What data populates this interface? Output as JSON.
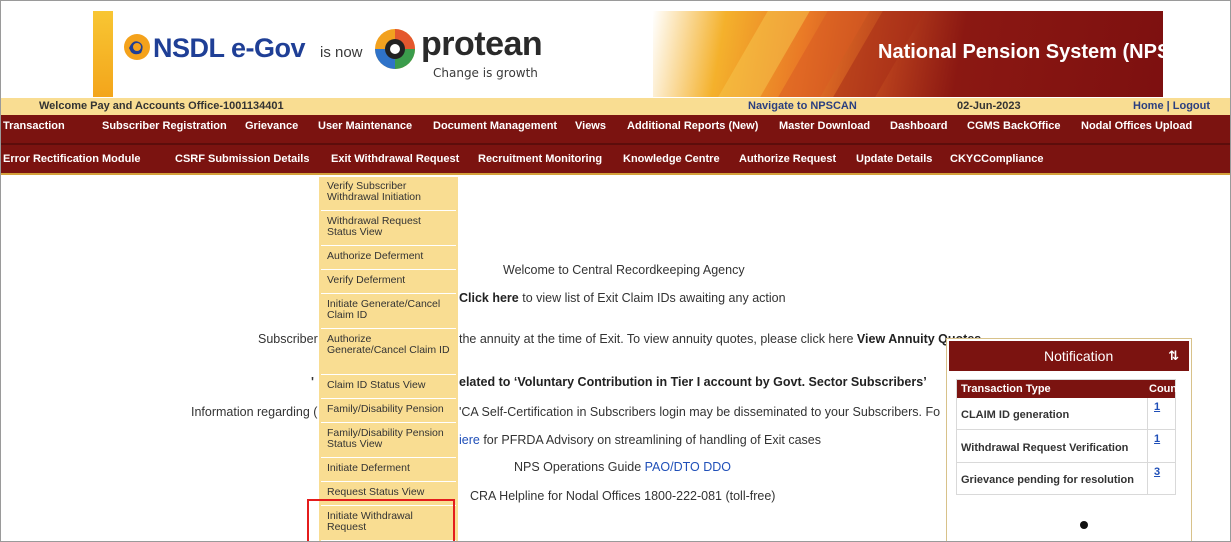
{
  "banner": {
    "nsdl_brand": "NSDL e-Gov",
    "is_now": "is now",
    "protean_brand": "protean",
    "tagline": "Change is growth",
    "system_title": "National Pension System (NPS)"
  },
  "infobar": {
    "welcome": "Welcome Pay and Accounts Office-1001134401",
    "navigate": "Navigate to NPSCAN",
    "date": "02-Jun-2023",
    "home_logout": "Home | Logout"
  },
  "menu_row1": [
    "Transaction",
    "Subscriber Registration",
    "Grievance",
    "User Maintenance",
    "Document Management",
    "Views",
    "Additional Reports (New)",
    "Master Download",
    "Dashboard",
    "CGMS BackOffice",
    "Nodal Offices Upload"
  ],
  "menu_row2": [
    "Error Rectification Module",
    "CSRF Submission Details",
    "Exit Withdrawal Request",
    "Recruitment Monitoring",
    "Knowledge Centre",
    "Authorize Request",
    "Update Details",
    "CKYCCompliance"
  ],
  "dropdown": [
    "Verify Subscriber Withdrawal Initiation",
    "Withdrawal Request Status View",
    "Authorize Deferment",
    "Verify Deferment",
    "Initiate Generate/Cancel Claim ID",
    "Authorize Generate/Cancel Claim ID",
    "Claim ID Status View",
    "Family/Disability Pension",
    "Family/Disability Pension Status View",
    "Initiate Deferment",
    "Request Status View",
    "Initiate Withdrawal Request"
  ],
  "body": {
    "welcome": "Welcome to Central Recordkeeping Agency",
    "click_here": "Click here",
    "click_here_rest": "to view list of Exit Claim IDs awaiting any action",
    "annuity_prefix": "Subscriber",
    "annuity_text": "the annuity at the time of Exit. To view annuity quotes, please click here",
    "annuity_link": "View Annuity Quotes",
    "voluntary_prefix": "'",
    "voluntary_text": "elated to ‘Voluntary Contribution in Tier I account by Govt. Sector Subscribers’",
    "info_prefix": "Information regarding (",
    "info_text": "'CA Self-Certification in Subscribers login may be disseminated to your Subscribers. Fo",
    "pfrda_link": "iere",
    "pfrda_text": "for PFRDA Advisory on streamlining of handling of Exit cases",
    "ops_guide": "NPS Operations Guide",
    "ops_link": "PAO/DTO DDO",
    "helpline": "CRA Helpline for Nodal Offices 1800-222-081 (toll-free)"
  },
  "notification": {
    "title": "Notification",
    "sort_icon": "sort-icon",
    "col_type": "Transaction Type",
    "col_count": "Count",
    "rows": [
      {
        "type": "CLAIM ID generation",
        "count": "1"
      },
      {
        "type": "Withdrawal Request Verification",
        "count": "1"
      },
      {
        "type": "Grievance pending for resolution",
        "count": "3"
      }
    ]
  },
  "colors": {
    "maroon": "#7b1310",
    "cream": "#f9dd92",
    "highlight_red": "#e41c1c",
    "link_blue": "#1f4fb8"
  }
}
